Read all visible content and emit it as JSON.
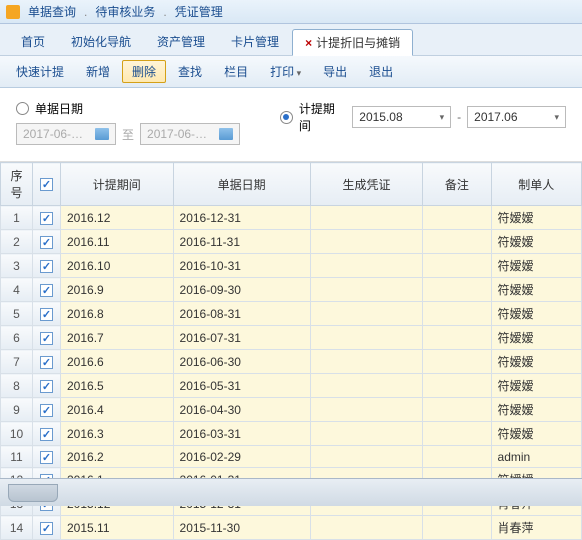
{
  "top_menu": {
    "items": [
      "单据查询",
      "待审核业务",
      "凭证管理"
    ]
  },
  "tabs": [
    "首页",
    "初始化导航",
    "资产管理",
    "卡片管理",
    "计提折旧与摊销"
  ],
  "active_tab": 4,
  "toolbar": [
    "快速计提",
    "新增",
    "删除",
    "查找",
    "栏目",
    "打印",
    "导出",
    "退出"
  ],
  "toolbar_active": 2,
  "toolbar_arrow": [
    5
  ],
  "filter": {
    "by_doc_date": "单据日期",
    "by_accrual": "计提期间",
    "selected": "accrual",
    "doc_from": "2017-06-…",
    "doc_to": "2017-06-…",
    "to_label": "至",
    "accrual_from": "2015.08",
    "accrual_to": "2017.06",
    "dash": "-"
  },
  "table": {
    "headers": [
      "序号",
      "",
      "计提期间",
      "单据日期",
      "生成凭证",
      "备注",
      "制单人"
    ],
    "rows": [
      {
        "n": "1",
        "period": "2016.12",
        "date": "2016-12-31",
        "voucher": "",
        "note": "",
        "maker": "符嫒嫒"
      },
      {
        "n": "2",
        "period": "2016.11",
        "date": "2016-11-31",
        "voucher": "",
        "note": "",
        "maker": "符嫒嫒"
      },
      {
        "n": "3",
        "period": "2016.10",
        "date": "2016-10-31",
        "voucher": "",
        "note": "",
        "maker": "符嫒嫒"
      },
      {
        "n": "4",
        "period": "2016.9",
        "date": "2016-09-30",
        "voucher": "",
        "note": "",
        "maker": "符嫒嫒"
      },
      {
        "n": "5",
        "period": "2016.8",
        "date": "2016-08-31",
        "voucher": "",
        "note": "",
        "maker": "符嫒嫒"
      },
      {
        "n": "6",
        "period": "2016.7",
        "date": "2016-07-31",
        "voucher": "",
        "note": "",
        "maker": "符嫒嫒"
      },
      {
        "n": "7",
        "period": "2016.6",
        "date": "2016-06-30",
        "voucher": "",
        "note": "",
        "maker": "符嫒嫒"
      },
      {
        "n": "8",
        "period": "2016.5",
        "date": "2016-05-31",
        "voucher": "",
        "note": "",
        "maker": "符嫒嫒"
      },
      {
        "n": "9",
        "period": "2016.4",
        "date": "2016-04-30",
        "voucher": "",
        "note": "",
        "maker": "符嫒嫒"
      },
      {
        "n": "10",
        "period": "2016.3",
        "date": "2016-03-31",
        "voucher": "",
        "note": "",
        "maker": "符嫒嫒"
      },
      {
        "n": "11",
        "period": "2016.2",
        "date": "2016-02-29",
        "voucher": "",
        "note": "",
        "maker": "admin"
      },
      {
        "n": "12",
        "period": "2016.1",
        "date": "2016-01-31",
        "voucher": "",
        "note": "",
        "maker": "符嫒嫒"
      },
      {
        "n": "13",
        "period": "2015.12",
        "date": "2015-12-31",
        "voucher": "",
        "note": "",
        "maker": "肖春萍"
      },
      {
        "n": "14",
        "period": "2015.11",
        "date": "2015-11-30",
        "voucher": "",
        "note": "",
        "maker": "肖春萍"
      }
    ]
  }
}
